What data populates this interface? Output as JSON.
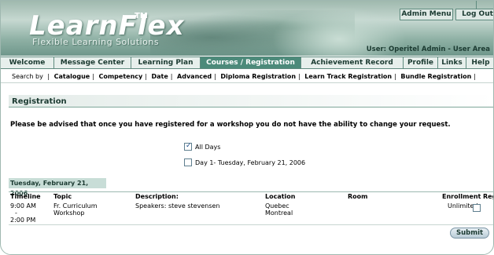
{
  "branding": {
    "logo": "LearnFlex",
    "trademark": "TM",
    "tagline": "Flexible Learning Solutions"
  },
  "top_buttons": {
    "admin_menu": "Admin Menu",
    "logout": "Log Out"
  },
  "user_info": "User: Operitel Admin - User Area",
  "nav": {
    "tabs": [
      {
        "label": "Welcome"
      },
      {
        "label": "Message Center"
      },
      {
        "label": "Learning Plan"
      },
      {
        "label": "Courses / Registration"
      },
      {
        "label": "Achievement Record"
      },
      {
        "label": "Profile"
      },
      {
        "label": "Links"
      },
      {
        "label": "Help"
      }
    ],
    "active": "Courses / Registration"
  },
  "subnav": {
    "label": "Search by",
    "items": [
      "Catalogue",
      "Competency",
      "Date",
      "Advanced",
      "Diploma Registration",
      "Learn Track Registration",
      "Bundle Registration"
    ]
  },
  "page": {
    "title": "Registration",
    "notice": "Please be advised that once you have registered for a workshop you do not have the ability to change your request.",
    "options": [
      {
        "label": "All Days",
        "checked": true
      },
      {
        "label": "Day 1- Tuesday, February 21, 2006",
        "checked": false
      }
    ],
    "date_header": "Tuesday, February 21, 2006"
  },
  "table": {
    "headers": {
      "timeline": "Timeline",
      "topic": "Topic",
      "description": "Description:",
      "location": "Location",
      "room": "Room",
      "enrollment": "Enrollment",
      "register": "Register"
    },
    "rows": [
      {
        "time_start": "9:00 AM",
        "time_sep": "-",
        "time_end": "2:00 PM",
        "topic_line1": "Fr. Curriculum",
        "topic_line2": "Workshop",
        "description": "Speakers: steve stevensen",
        "location_line1": "Quebec",
        "location_line2": "Montreal",
        "room": "",
        "enrollment": "Unlimited",
        "register_checked": false
      }
    ]
  },
  "submit_label": "Submit",
  "colors": {
    "accent": "#4c8a7a",
    "nav_bg": "#e7efec",
    "date_bar": "#c8ddd7"
  }
}
